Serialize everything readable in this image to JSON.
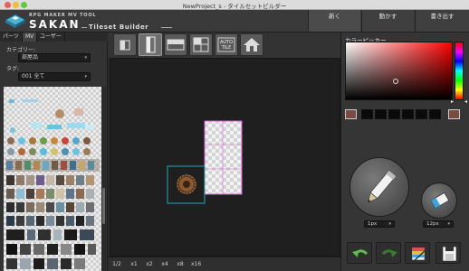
{
  "window": {
    "title": "NewProject_s - タイルセットビルダー"
  },
  "header": {
    "logo_sub": "RPG MAKER MV TOOL",
    "logo_main": "SAKAN",
    "logo_tag": "Tileset Builder",
    "buttons": [
      {
        "label": "新く",
        "active": true
      },
      {
        "label": "動かす",
        "active": false
      },
      {
        "label": "書き出す",
        "active": false
      }
    ]
  },
  "left": {
    "tabs": [
      {
        "label": "パーツ",
        "active": false
      },
      {
        "label": "MV",
        "active": true
      },
      {
        "label": "ユーザー",
        "active": false
      }
    ],
    "category_label": "カテゴリー:",
    "category_value": "部屋品",
    "tag_label": "タグ:",
    "tag_value": "001 全て"
  },
  "toolbar": {
    "buttons": [
      {
        "icon": "half-tile-icon",
        "selected": false
      },
      {
        "icon": "tall-tile-icon",
        "selected": true
      },
      {
        "icon": "wide-tile-icon",
        "selected": false
      },
      {
        "icon": "quad-tile-icon",
        "selected": false
      },
      {
        "icon": "auto-tile-icon",
        "selected": false
      },
      {
        "icon": "home-icon",
        "selected": false
      }
    ],
    "auto_label_top": "AUTO",
    "auto_label_bottom": "TILE"
  },
  "zoom": {
    "options": [
      "1/2",
      "x1",
      "x2",
      "x4",
      "x8",
      "x16"
    ]
  },
  "right": {
    "picker_title": "カラーピッカー",
    "current_color": "#7a4a45",
    "pen_size": "1px",
    "eraser_size": "12px"
  }
}
